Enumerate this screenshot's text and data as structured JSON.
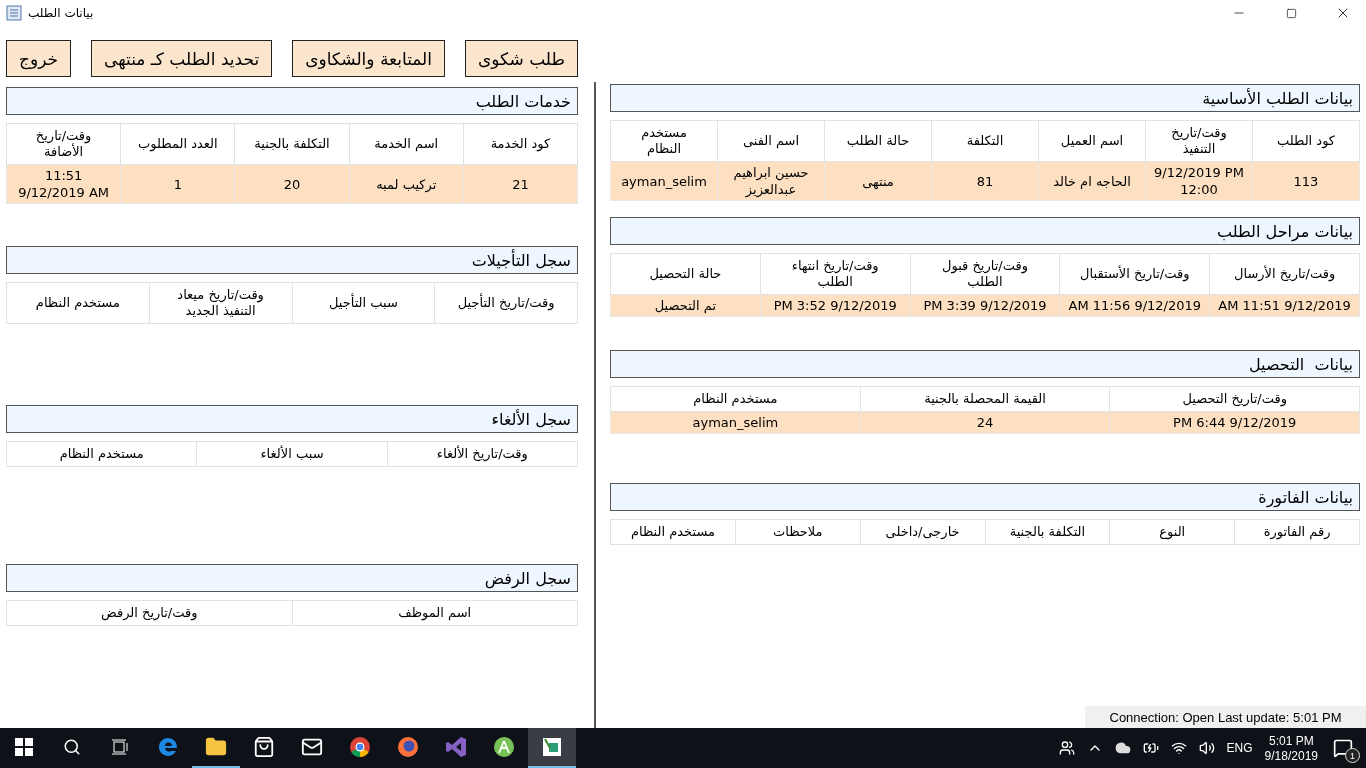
{
  "window": {
    "title": "بيانات الطلب"
  },
  "buttons": [
    "طلب شكوى",
    "المتابعة والشكاوى",
    "تحديد الطلب كـ منتهى",
    "خروج"
  ],
  "right_sections": [
    {
      "title": "بيانات الطلب الأساسية",
      "columns": [
        "كود الطلب",
        "وقت/تاريخ التنفيذ",
        "اسم العميل",
        "التكلفة",
        "حالة الطلب",
        "اسم الفنى",
        "مستخدم النظام"
      ],
      "rows": [
        [
          "113",
          "9/12/2019 PM 12:00",
          "الحاجه ام خالد",
          "81",
          "منتهى",
          "حسين ابراهيم عبدالعزيز",
          "ayman_selim"
        ]
      ]
    },
    {
      "title": "بيانات مراحل الطلب",
      "columns": [
        "وقت/تاريخ الأرسال",
        "وقت/تاريخ الأستقبال",
        "وقت/تاريخ قبول الطلب",
        "وقت/تاريخ انتهاء الطلب",
        "حالة التحصيل"
      ],
      "rows": [
        [
          "AM 11:51 9/12/2019",
          "AM 11:56 9/12/2019",
          "PM 3:39 9/12/2019",
          "PM 3:52 9/12/2019",
          "تم التحصيل"
        ]
      ]
    },
    {
      "title": "بيانات  التحصيل",
      "columns": [
        "وقت/تاريخ التحصيل",
        "القيمة المحصلة بالجنية",
        "مستخدم النظام"
      ],
      "rows": [
        [
          "PM 6:44 9/12/2019",
          "24",
          "ayman_selim"
        ]
      ]
    },
    {
      "title": "بيانات الفاتورة",
      "columns": [
        "رقم الفاتورة",
        "النوع",
        "التكلفة بالجنية",
        "خارجى/داخلى",
        "ملاحظات",
        "مستخدم النظام"
      ]
    }
  ],
  "left_sections": [
    {
      "title": "خدمات الطلب",
      "columns": [
        "كود الخدمة",
        "اسم الخدمة",
        "التكلفة بالجنية",
        "العدد المطلوب",
        "وقت/تاريخ الأضافة"
      ],
      "rows": [
        [
          "21",
          "تركيب لمبه",
          "20",
          "1",
          "11:51 9/12/2019 AM"
        ]
      ]
    },
    {
      "title": "سجل التأجيلات",
      "columns": [
        "وقت/تاريخ التأجيل",
        "سبب التأجيل",
        "وقت/تاريخ ميعاد التنفيذ الجديد",
        "مستخدم النظام"
      ]
    },
    {
      "title": "سجل الألغاء",
      "columns": [
        "وقت/تاريخ الألغاء",
        "سبب الألغاء",
        "مستخدم النظام"
      ]
    },
    {
      "title": "سجل الرفض",
      "columns": [
        "اسم الموظف",
        "وقت/تاريخ الرفض"
      ]
    }
  ],
  "status_bar": "Connection: Open Last update: 5:01 PM",
  "taskbar": {
    "apps": [
      {
        "kind": "edge",
        "running": false,
        "active": false
      },
      {
        "kind": "folder",
        "running": true,
        "active": false
      },
      {
        "kind": "store",
        "running": false,
        "active": false
      },
      {
        "kind": "mail",
        "running": false,
        "active": false
      },
      {
        "kind": "chrome",
        "running": false,
        "active": false
      },
      {
        "kind": "firefox",
        "running": false,
        "active": false
      },
      {
        "kind": "studio",
        "running": false,
        "active": false
      },
      {
        "kind": "android",
        "running": false,
        "active": false
      },
      {
        "kind": "app",
        "running": true,
        "active": true
      }
    ],
    "language": "ENG",
    "time": "5:01 PM",
    "date": "9/18/2019",
    "notifications": "1"
  }
}
